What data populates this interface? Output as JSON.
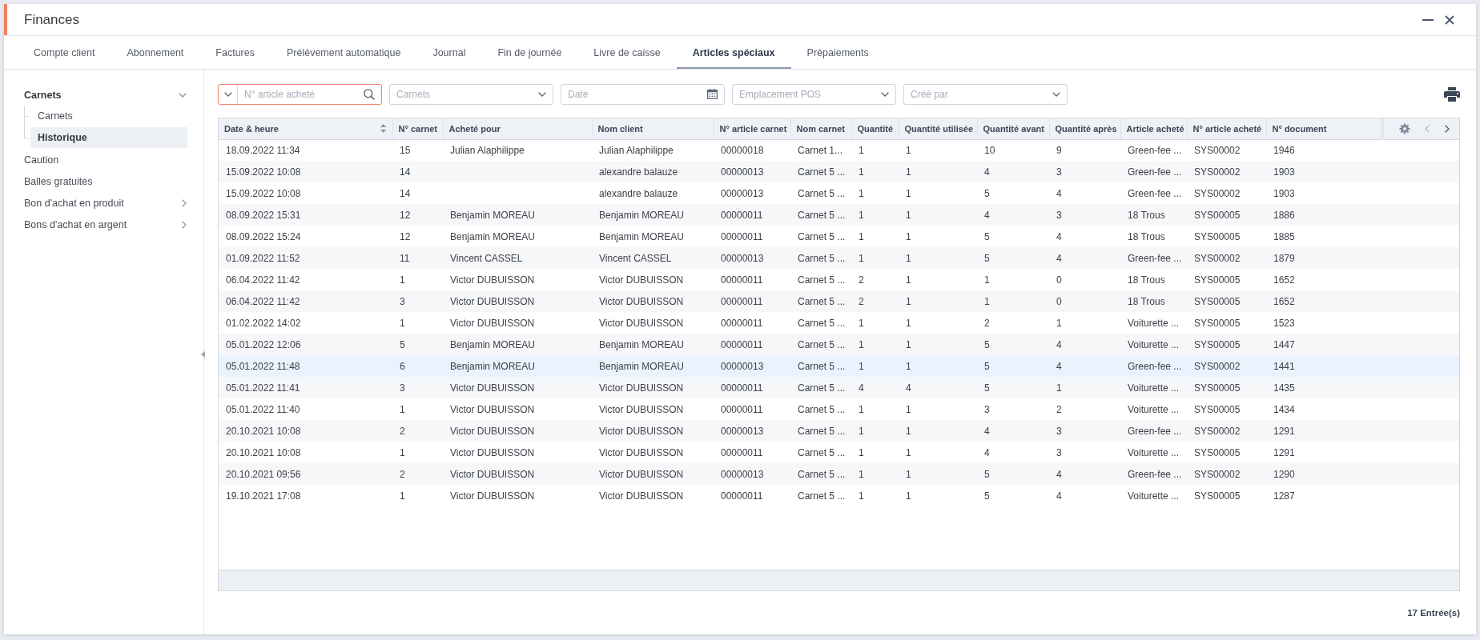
{
  "window": {
    "title": "Finances"
  },
  "tabs": [
    {
      "label": "Compte client",
      "selected": false
    },
    {
      "label": "Abonnement",
      "selected": false
    },
    {
      "label": "Factures",
      "selected": false
    },
    {
      "label": "Prélèvement automatique",
      "selected": false
    },
    {
      "label": "Journal",
      "selected": false
    },
    {
      "label": "Fin de journée",
      "selected": false
    },
    {
      "label": "Livre de caisse",
      "selected": false
    },
    {
      "label": "Articles spéciaux",
      "selected": true
    },
    {
      "label": "Prépaiements",
      "selected": false
    }
  ],
  "sidebar": {
    "items": [
      {
        "kind": "group",
        "label": "Carnets",
        "selected": false,
        "expanded": true,
        "children": [
          {
            "label": "Carnets",
            "selected": false
          },
          {
            "label": "Historique",
            "selected": true
          }
        ]
      },
      {
        "kind": "link",
        "label": "Caution",
        "selected": false
      },
      {
        "kind": "link",
        "label": "Balles gratuites",
        "selected": false
      },
      {
        "kind": "group",
        "label": "Bon d'achat en produit",
        "selected": false,
        "expanded": false
      },
      {
        "kind": "group",
        "label": "Bons d'achat en argent",
        "selected": false,
        "expanded": false
      }
    ]
  },
  "filters": [
    {
      "kind": "search",
      "placeholder": "N° article acheté",
      "focused": true
    },
    {
      "kind": "select",
      "placeholder": "Carnets",
      "focused": false
    },
    {
      "kind": "date",
      "placeholder": "Date",
      "focused": false
    },
    {
      "kind": "select",
      "placeholder": "Emplacement POS",
      "focused": false
    },
    {
      "kind": "select",
      "placeholder": "Créé par",
      "focused": false
    }
  ],
  "table": {
    "columns": [
      {
        "label": "Date & heure",
        "sortable": true
      },
      {
        "label": "N° carnet",
        "sortable": false
      },
      {
        "label": "Acheté pour",
        "sortable": false
      },
      {
        "label": "Nom client",
        "sortable": false
      },
      {
        "label": "N° article carnet",
        "sortable": false
      },
      {
        "label": "Nom carnet",
        "sortable": false
      },
      {
        "label": "Quantité",
        "sortable": false
      },
      {
        "label": "Quantité utilisée",
        "sortable": false
      },
      {
        "label": "Quantité avant",
        "sortable": false
      },
      {
        "label": "Quantité après",
        "sortable": false
      },
      {
        "label": "Article acheté",
        "sortable": false
      },
      {
        "label": "N° article acheté",
        "sortable": false
      },
      {
        "label": "N° document",
        "sortable": false
      }
    ],
    "pager": {
      "previous": {
        "disabled": true
      },
      "next": {
        "disabled": false
      }
    },
    "rows": [
      {
        "selected": false,
        "cells": [
          "18.09.2022 11:34",
          "15",
          "Julian Alaphilippe",
          "Julian Alaphilippe",
          "00000018",
          "Carnet 1...",
          "1",
          "1",
          "10",
          "9",
          "Green-fee ...",
          "SYS00002",
          "1946"
        ]
      },
      {
        "selected": false,
        "cells": [
          "15.09.2022 10:08",
          "14",
          null,
          "alexandre balauze",
          "00000013",
          "Carnet 5 ...",
          "1",
          "1",
          "4",
          "3",
          "Green-fee ...",
          "SYS00002",
          "1903"
        ]
      },
      {
        "selected": false,
        "cells": [
          "15.09.2022 10:08",
          "14",
          null,
          "alexandre balauze",
          "00000013",
          "Carnet 5 ...",
          "1",
          "1",
          "5",
          "4",
          "Green-fee ...",
          "SYS00002",
          "1903"
        ]
      },
      {
        "selected": false,
        "cells": [
          "08.09.2022 15:31",
          "12",
          "Benjamin MOREAU",
          "Benjamin MOREAU",
          "00000011",
          "Carnet 5 ...",
          "1",
          "1",
          "4",
          "3",
          "18 Trous",
          "SYS00005",
          "1886"
        ]
      },
      {
        "selected": false,
        "cells": [
          "08.09.2022 15:24",
          "12",
          "Benjamin MOREAU",
          "Benjamin MOREAU",
          "00000011",
          "Carnet 5 ...",
          "1",
          "1",
          "5",
          "4",
          "18 Trous",
          "SYS00005",
          "1885"
        ]
      },
      {
        "selected": false,
        "cells": [
          "01.09.2022 11:52",
          "11",
          "Vincent CASSEL",
          "Vincent CASSEL",
          "00000013",
          "Carnet 5 ...",
          "1",
          "1",
          "5",
          "4",
          "Green-fee ...",
          "SYS00002",
          "1879"
        ]
      },
      {
        "selected": false,
        "cells": [
          "06.04.2022 11:42",
          "1",
          "Victor DUBUISSON",
          "Victor DUBUISSON",
          "00000011",
          "Carnet 5 ...",
          "2",
          "1",
          "1",
          "0",
          "18 Trous",
          "SYS00005",
          "1652"
        ]
      },
      {
        "selected": false,
        "cells": [
          "06.04.2022 11:42",
          "3",
          "Victor DUBUISSON",
          "Victor DUBUISSON",
          "00000011",
          "Carnet 5 ...",
          "2",
          "1",
          "1",
          "0",
          "18 Trous",
          "SYS00005",
          "1652"
        ]
      },
      {
        "selected": false,
        "cells": [
          "01.02.2022 14:02",
          "1",
          "Victor DUBUISSON",
          "Victor DUBUISSON",
          "00000011",
          "Carnet 5 ...",
          "1",
          "1",
          "2",
          "1",
          "Voiturette ...",
          "SYS00005",
          "1523"
        ]
      },
      {
        "selected": false,
        "cells": [
          "05.01.2022 12:06",
          "5",
          "Benjamin MOREAU",
          "Benjamin MOREAU",
          "00000011",
          "Carnet 5 ...",
          "1",
          "1",
          "5",
          "4",
          "Voiturette ...",
          "SYS00005",
          "1447"
        ]
      },
      {
        "selected": true,
        "cells": [
          "05.01.2022 11:48",
          "6",
          "Benjamin MOREAU",
          "Benjamin MOREAU",
          "00000013",
          "Carnet 5 ...",
          "1",
          "1",
          "5",
          "4",
          "Green-fee ...",
          "SYS00002",
          "1441"
        ]
      },
      {
        "selected": false,
        "cells": [
          "05.01.2022 11:41",
          "3",
          "Victor DUBUISSON",
          "Victor DUBUISSON",
          "00000011",
          "Carnet 5 ...",
          "4",
          "4",
          "5",
          "1",
          "Voiturette ...",
          "SYS00005",
          "1435"
        ]
      },
      {
        "selected": false,
        "cells": [
          "05.01.2022 11:40",
          "1",
          "Victor DUBUISSON",
          "Victor DUBUISSON",
          "00000011",
          "Carnet 5 ...",
          "1",
          "1",
          "3",
          "2",
          "Voiturette ...",
          "SYS00005",
          "1434"
        ]
      },
      {
        "selected": false,
        "cells": [
          "20.10.2021 10:08",
          "2",
          "Victor DUBUISSON",
          "Victor DUBUISSON",
          "00000013",
          "Carnet 5 ...",
          "1",
          "1",
          "4",
          "3",
          "Green-fee ...",
          "SYS00002",
          "1291"
        ]
      },
      {
        "selected": false,
        "cells": [
          "20.10.2021 10:08",
          "1",
          "Victor DUBUISSON",
          "Victor DUBUISSON",
          "00000011",
          "Carnet 5 ...",
          "1",
          "1",
          "4",
          "3",
          "Voiturette ...",
          "SYS00005",
          "1291"
        ]
      },
      {
        "selected": false,
        "cells": [
          "20.10.2021 09:56",
          "2",
          "Victor DUBUISSON",
          "Victor DUBUISSON",
          "00000013",
          "Carnet 5 ...",
          "1",
          "1",
          "5",
          "4",
          "Green-fee ...",
          "SYS00002",
          "1290"
        ]
      },
      {
        "selected": false,
        "cells": [
          "19.10.2021 17:08",
          "1",
          "Victor DUBUISSON",
          "Victor DUBUISSON",
          "00000011",
          "Carnet 5 ...",
          "1",
          "1",
          "5",
          "4",
          "Voiturette ...",
          "SYS00005",
          "1287"
        ]
      }
    ]
  },
  "status_bar": {
    "entry_count": "17 Entrée(s)"
  }
}
